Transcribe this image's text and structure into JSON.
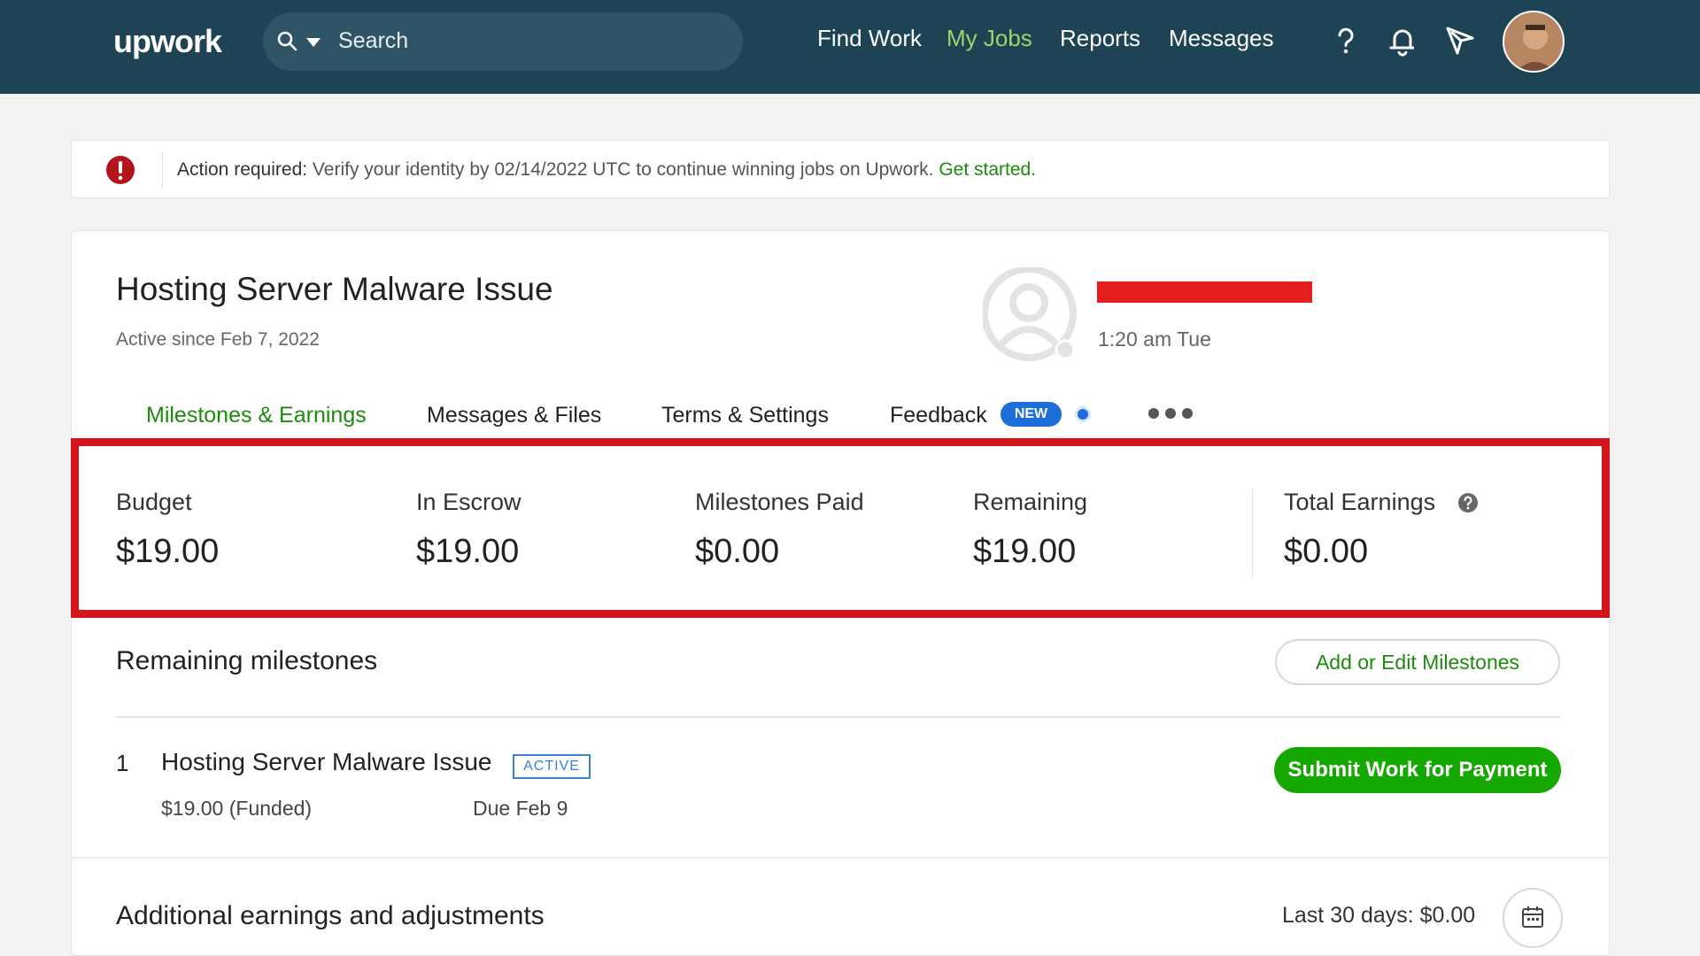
{
  "nav": {
    "logo": "upwork",
    "search_placeholder": "Search",
    "links": [
      "Find Work",
      "My Jobs",
      "Reports",
      "Messages"
    ],
    "icons": [
      "help-icon",
      "bell-icon",
      "send-icon",
      "avatar"
    ]
  },
  "alert": {
    "label": "Action required:",
    "message": " Verify your identity by 02/14/2022 UTC to continue winning jobs on Upwork. ",
    "link": "Get started."
  },
  "job": {
    "title": "Hosting Server Malware Issue",
    "active_since": "Active since Feb 7, 2022",
    "client_time": "1:20 am Tue"
  },
  "tabs": [
    {
      "label": "Milestones & Earnings",
      "active": true
    },
    {
      "label": "Messages & Files"
    },
    {
      "label": "Terms & Settings"
    },
    {
      "label": "Feedback",
      "badge": "NEW"
    }
  ],
  "stats": [
    {
      "label": "Budget",
      "value": "$19.00"
    },
    {
      "label": "In Escrow",
      "value": "$19.00"
    },
    {
      "label": "Milestones Paid",
      "value": "$0.00"
    },
    {
      "label": "Remaining",
      "value": "$19.00"
    },
    {
      "label": "Total Earnings",
      "value": "$0.00"
    }
  ],
  "milestones": {
    "heading": "Remaining milestones",
    "edit_button": "Add or Edit Milestones",
    "items": [
      {
        "number": "1",
        "title": "Hosting Server Malware Issue",
        "status": "ACTIVE",
        "amount": "$19.00 (Funded)",
        "due": "Due Feb 9",
        "action": "Submit Work for Payment"
      }
    ]
  },
  "additional": {
    "heading": "Additional earnings and adjustments",
    "last30": "Last 30 days: $0.00"
  },
  "colors": {
    "nav_bg": "#1d4354",
    "brand_green": "#14a800",
    "link_green": "#1d8a0e",
    "highlight_red": "#d6141b",
    "badge_blue": "#1c6fd9"
  }
}
